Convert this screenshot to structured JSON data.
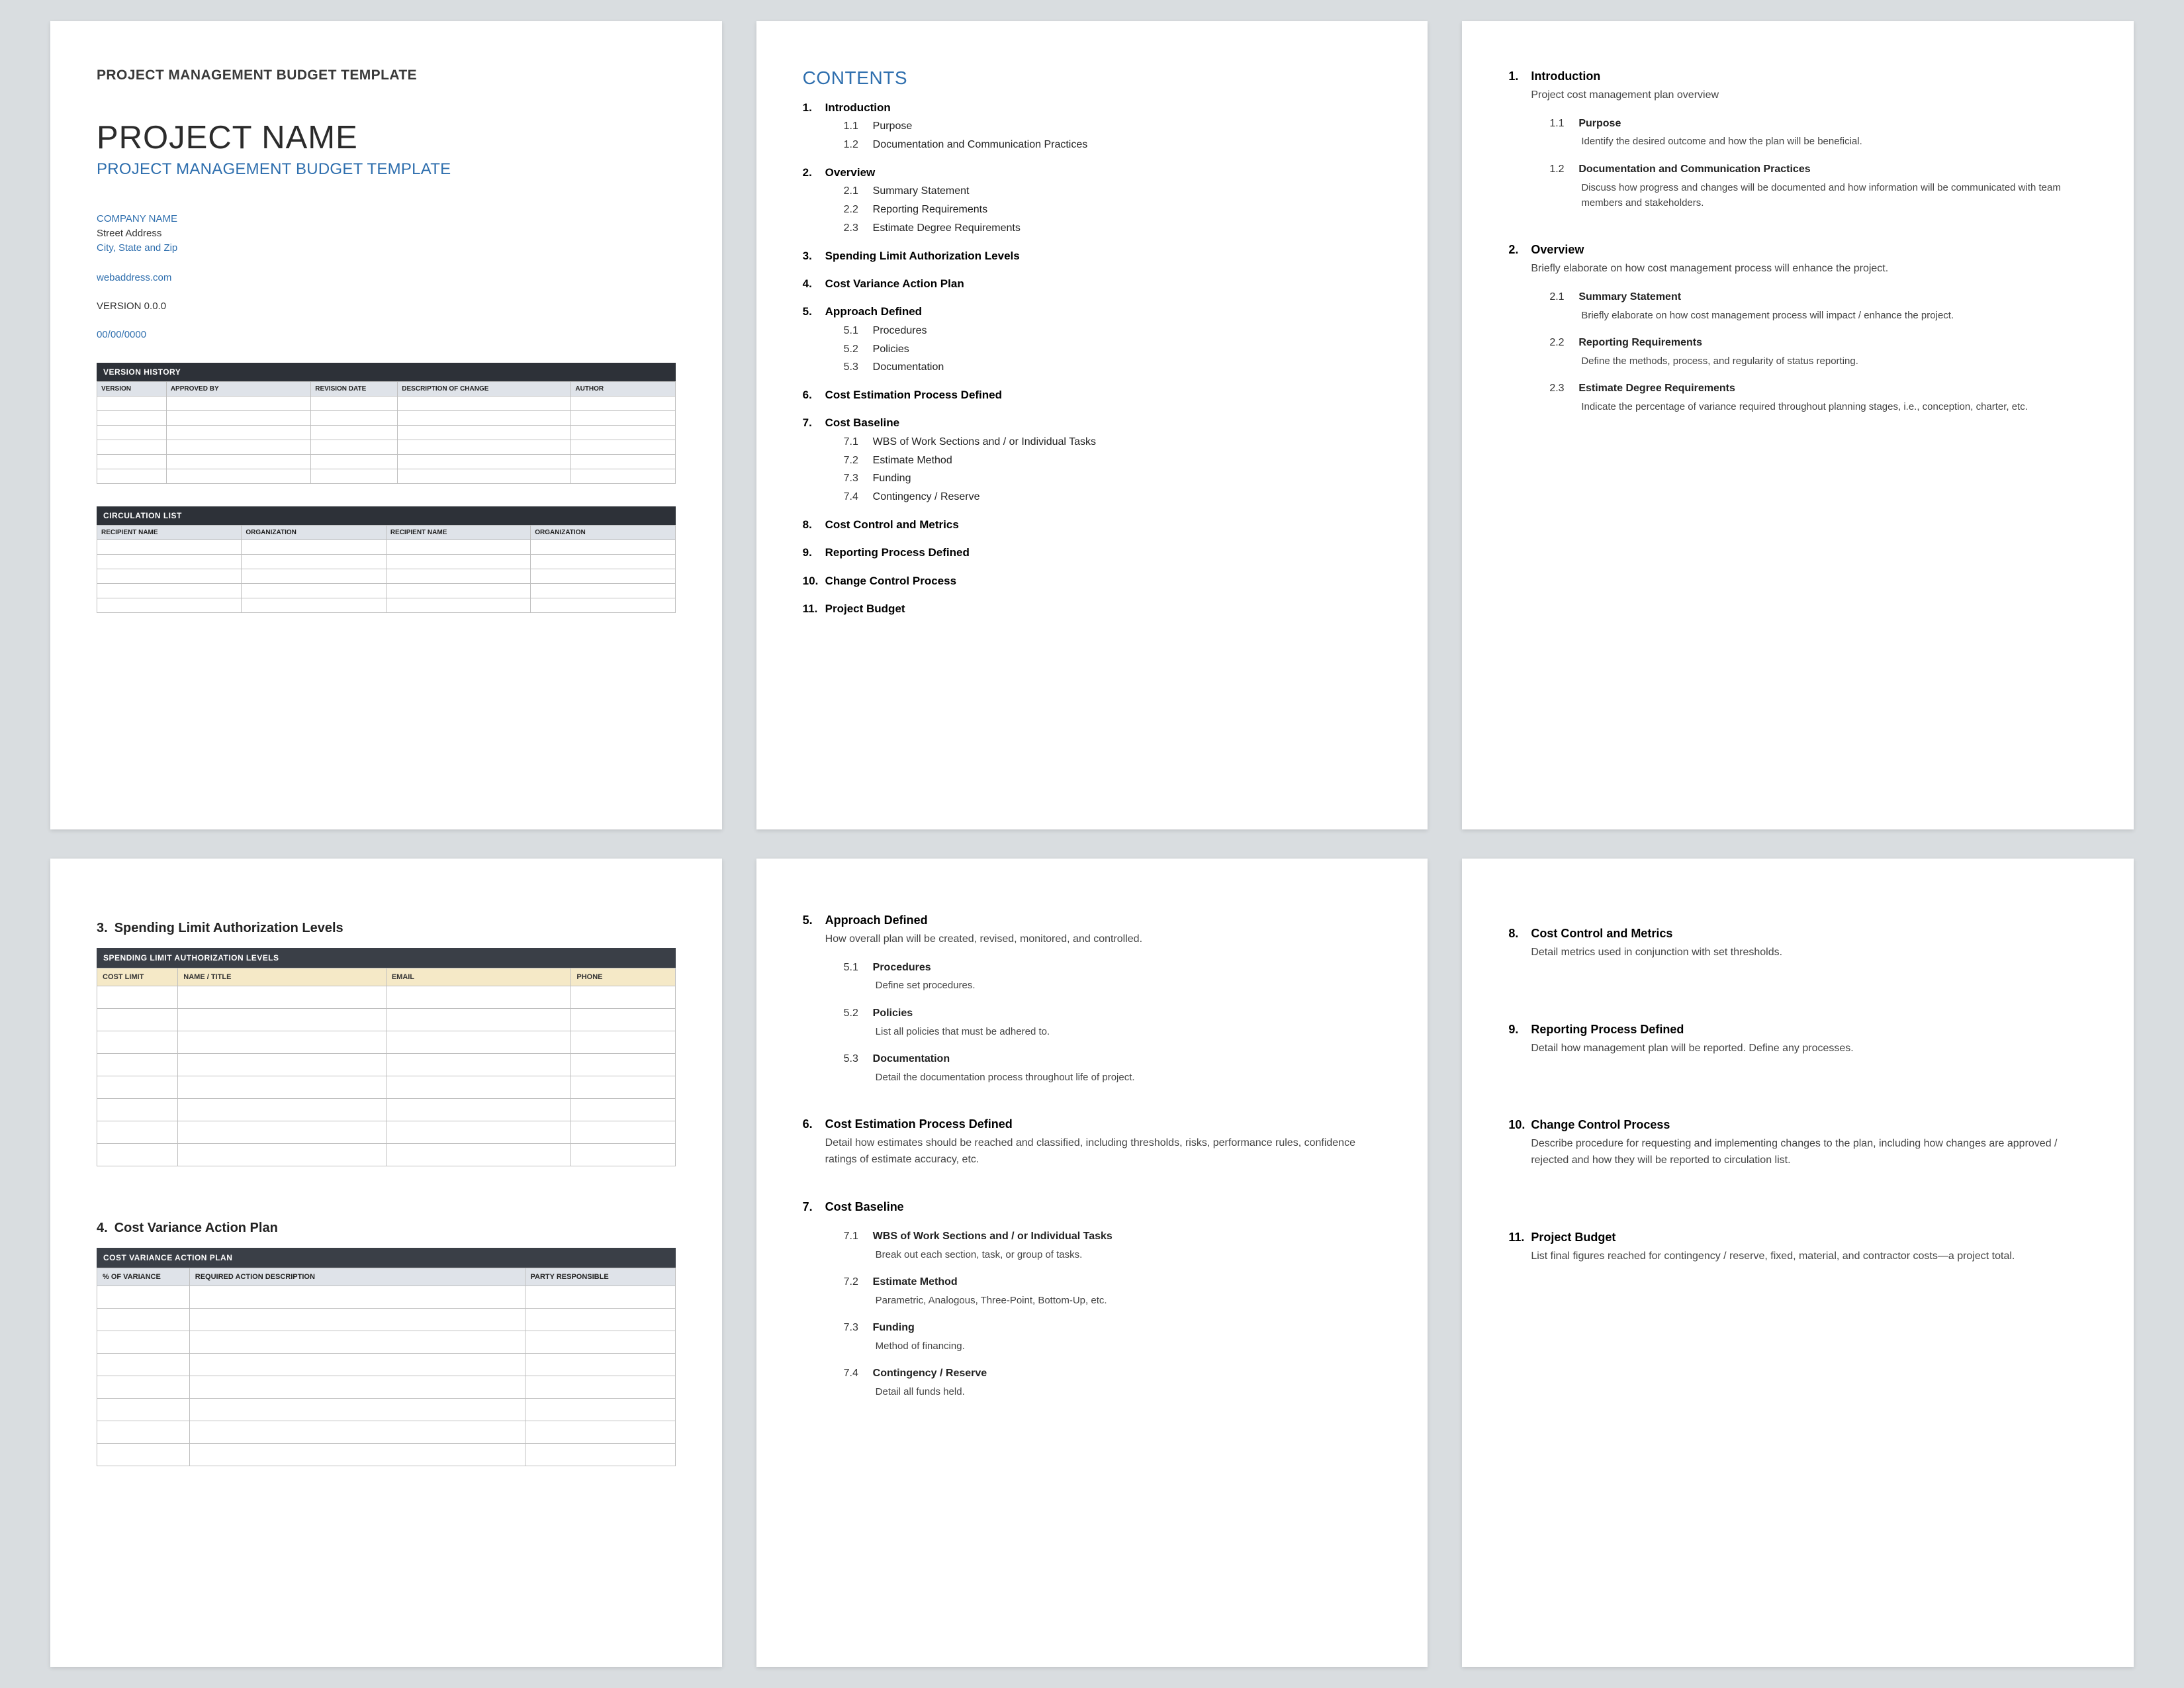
{
  "page1": {
    "doc_header": "PROJECT MANAGEMENT BUDGET TEMPLATE",
    "title": "PROJECT NAME",
    "subtitle": "PROJECT MANAGEMENT BUDGET TEMPLATE",
    "company_name": "COMPANY NAME",
    "street": "Street Address",
    "city_state_zip": "City, State and Zip",
    "web": "webaddress.com",
    "version": "VERSION 0.0.0",
    "date": "00/00/0000",
    "version_history": {
      "title": "VERSION HISTORY",
      "cols": [
        "VERSION",
        "APPROVED BY",
        "REVISION DATE",
        "DESCRIPTION OF CHANGE",
        "AUTHOR"
      ]
    },
    "circulation": {
      "title": "CIRCULATION LIST",
      "cols": [
        "RECIPIENT NAME",
        "ORGANIZATION",
        "RECIPIENT NAME",
        "ORGANIZATION"
      ]
    }
  },
  "contents": {
    "heading": "CONTENTS",
    "items": [
      {
        "n": "1",
        "label": "Introduction",
        "sub": [
          {
            "n": "1.1",
            "label": "Purpose"
          },
          {
            "n": "1.2",
            "label": "Documentation and Communication Practices"
          }
        ]
      },
      {
        "n": "2",
        "label": "Overview",
        "sub": [
          {
            "n": "2.1",
            "label": "Summary Statement"
          },
          {
            "n": "2.2",
            "label": "Reporting Requirements"
          },
          {
            "n": "2.3",
            "label": "Estimate Degree Requirements"
          }
        ]
      },
      {
        "n": "3",
        "label": "Spending Limit Authorization Levels"
      },
      {
        "n": "4",
        "label": "Cost Variance Action Plan"
      },
      {
        "n": "5",
        "label": "Approach Defined",
        "sub": [
          {
            "n": "5.1",
            "label": "Procedures"
          },
          {
            "n": "5.2",
            "label": "Policies"
          },
          {
            "n": "5.3",
            "label": "Documentation"
          }
        ]
      },
      {
        "n": "6",
        "label": "Cost Estimation Process Defined"
      },
      {
        "n": "7",
        "label": "Cost Baseline",
        "sub": [
          {
            "n": "7.1",
            "label": "WBS of Work Sections and / or Individual Tasks"
          },
          {
            "n": "7.2",
            "label": "Estimate Method"
          },
          {
            "n": "7.3",
            "label": "Funding"
          },
          {
            "n": "7.4",
            "label": "Contingency / Reserve"
          }
        ]
      },
      {
        "n": "8",
        "label": "Cost Control and Metrics"
      },
      {
        "n": "9",
        "label": "Reporting Process Defined"
      },
      {
        "n": "10",
        "label": "Change Control Process"
      },
      {
        "n": "11",
        "label": "Project Budget"
      }
    ]
  },
  "detail_a": [
    {
      "n": "1",
      "label": "Introduction",
      "desc": "Project cost management plan overview",
      "sub": [
        {
          "n": "1.1",
          "label": "Purpose",
          "desc": "Identify the desired outcome and how the plan will be beneficial."
        },
        {
          "n": "1.2",
          "label": "Documentation and Communication Practices",
          "desc": "Discuss how progress and changes will be documented and how information will be communicated with team members and stakeholders."
        }
      ]
    },
    {
      "n": "2",
      "label": "Overview",
      "desc": "Briefly elaborate on how cost management process will enhance the project.",
      "sub": [
        {
          "n": "2.1",
          "label": "Summary Statement",
          "desc": "Briefly elaborate on how cost management process will impact / enhance the project."
        },
        {
          "n": "2.2",
          "label": "Reporting Requirements",
          "desc": "Define the methods, process, and regularity of status reporting."
        },
        {
          "n": "2.3",
          "label": "Estimate Degree Requirements",
          "desc": "Indicate the percentage of variance required throughout planning stages, i.e., conception, charter, etc."
        }
      ]
    }
  ],
  "page4": {
    "sec3": {
      "n": "3",
      "label": "Spending Limit Authorization Levels"
    },
    "table3": {
      "title": "SPENDING LIMIT AUTHORIZATION LEVELS",
      "cols": [
        "COST LIMIT",
        "NAME / TITLE",
        "EMAIL",
        "PHONE"
      ]
    },
    "sec4": {
      "n": "4",
      "label": "Cost Variance Action Plan"
    },
    "table4": {
      "title": "COST VARIANCE ACTION PLAN",
      "cols": [
        "% OF VARIANCE",
        "REQUIRED ACTION DESCRIPTION",
        "PARTY RESPONSIBLE"
      ]
    }
  },
  "detail_b": [
    {
      "n": "5",
      "label": "Approach Defined",
      "desc": "How overall plan will be created, revised, monitored, and controlled.",
      "sub": [
        {
          "n": "5.1",
          "label": "Procedures",
          "desc": "Define set procedures."
        },
        {
          "n": "5.2",
          "label": "Policies",
          "desc": "List all policies that must be adhered to."
        },
        {
          "n": "5.3",
          "label": "Documentation",
          "desc": "Detail the documentation process throughout life of project."
        }
      ]
    },
    {
      "n": "6",
      "label": "Cost Estimation Process Defined",
      "desc": "Detail how estimates should be reached and classified, including thresholds, risks, performance rules, confidence ratings of estimate accuracy, etc."
    },
    {
      "n": "7",
      "label": "Cost Baseline",
      "sub": [
        {
          "n": "7.1",
          "label": "WBS of Work Sections and / or Individual Tasks",
          "desc": "Break out each section, task, or group of tasks."
        },
        {
          "n": "7.2",
          "label": "Estimate Method",
          "desc": "Parametric, Analogous, Three-Point, Bottom-Up, etc."
        },
        {
          "n": "7.3",
          "label": "Funding",
          "desc": "Method of financing."
        },
        {
          "n": "7.4",
          "label": "Contingency / Reserve",
          "desc": "Detail all funds held."
        }
      ]
    }
  ],
  "detail_c": [
    {
      "n": "8",
      "label": "Cost Control and Metrics",
      "desc": "Detail metrics used in conjunction with set thresholds."
    },
    {
      "n": "9",
      "label": "Reporting Process Defined",
      "desc": "Detail how management plan will be reported. Define any processes."
    },
    {
      "n": "10",
      "label": "Change Control Process",
      "desc": "Describe procedure for requesting and implementing changes to the plan, including how changes are approved / rejected and how they will be reported to circulation list."
    },
    {
      "n": "11",
      "label": "Project Budget",
      "desc": "List final figures reached for contingency / reserve, fixed, material, and contractor costs—a project total."
    }
  ]
}
